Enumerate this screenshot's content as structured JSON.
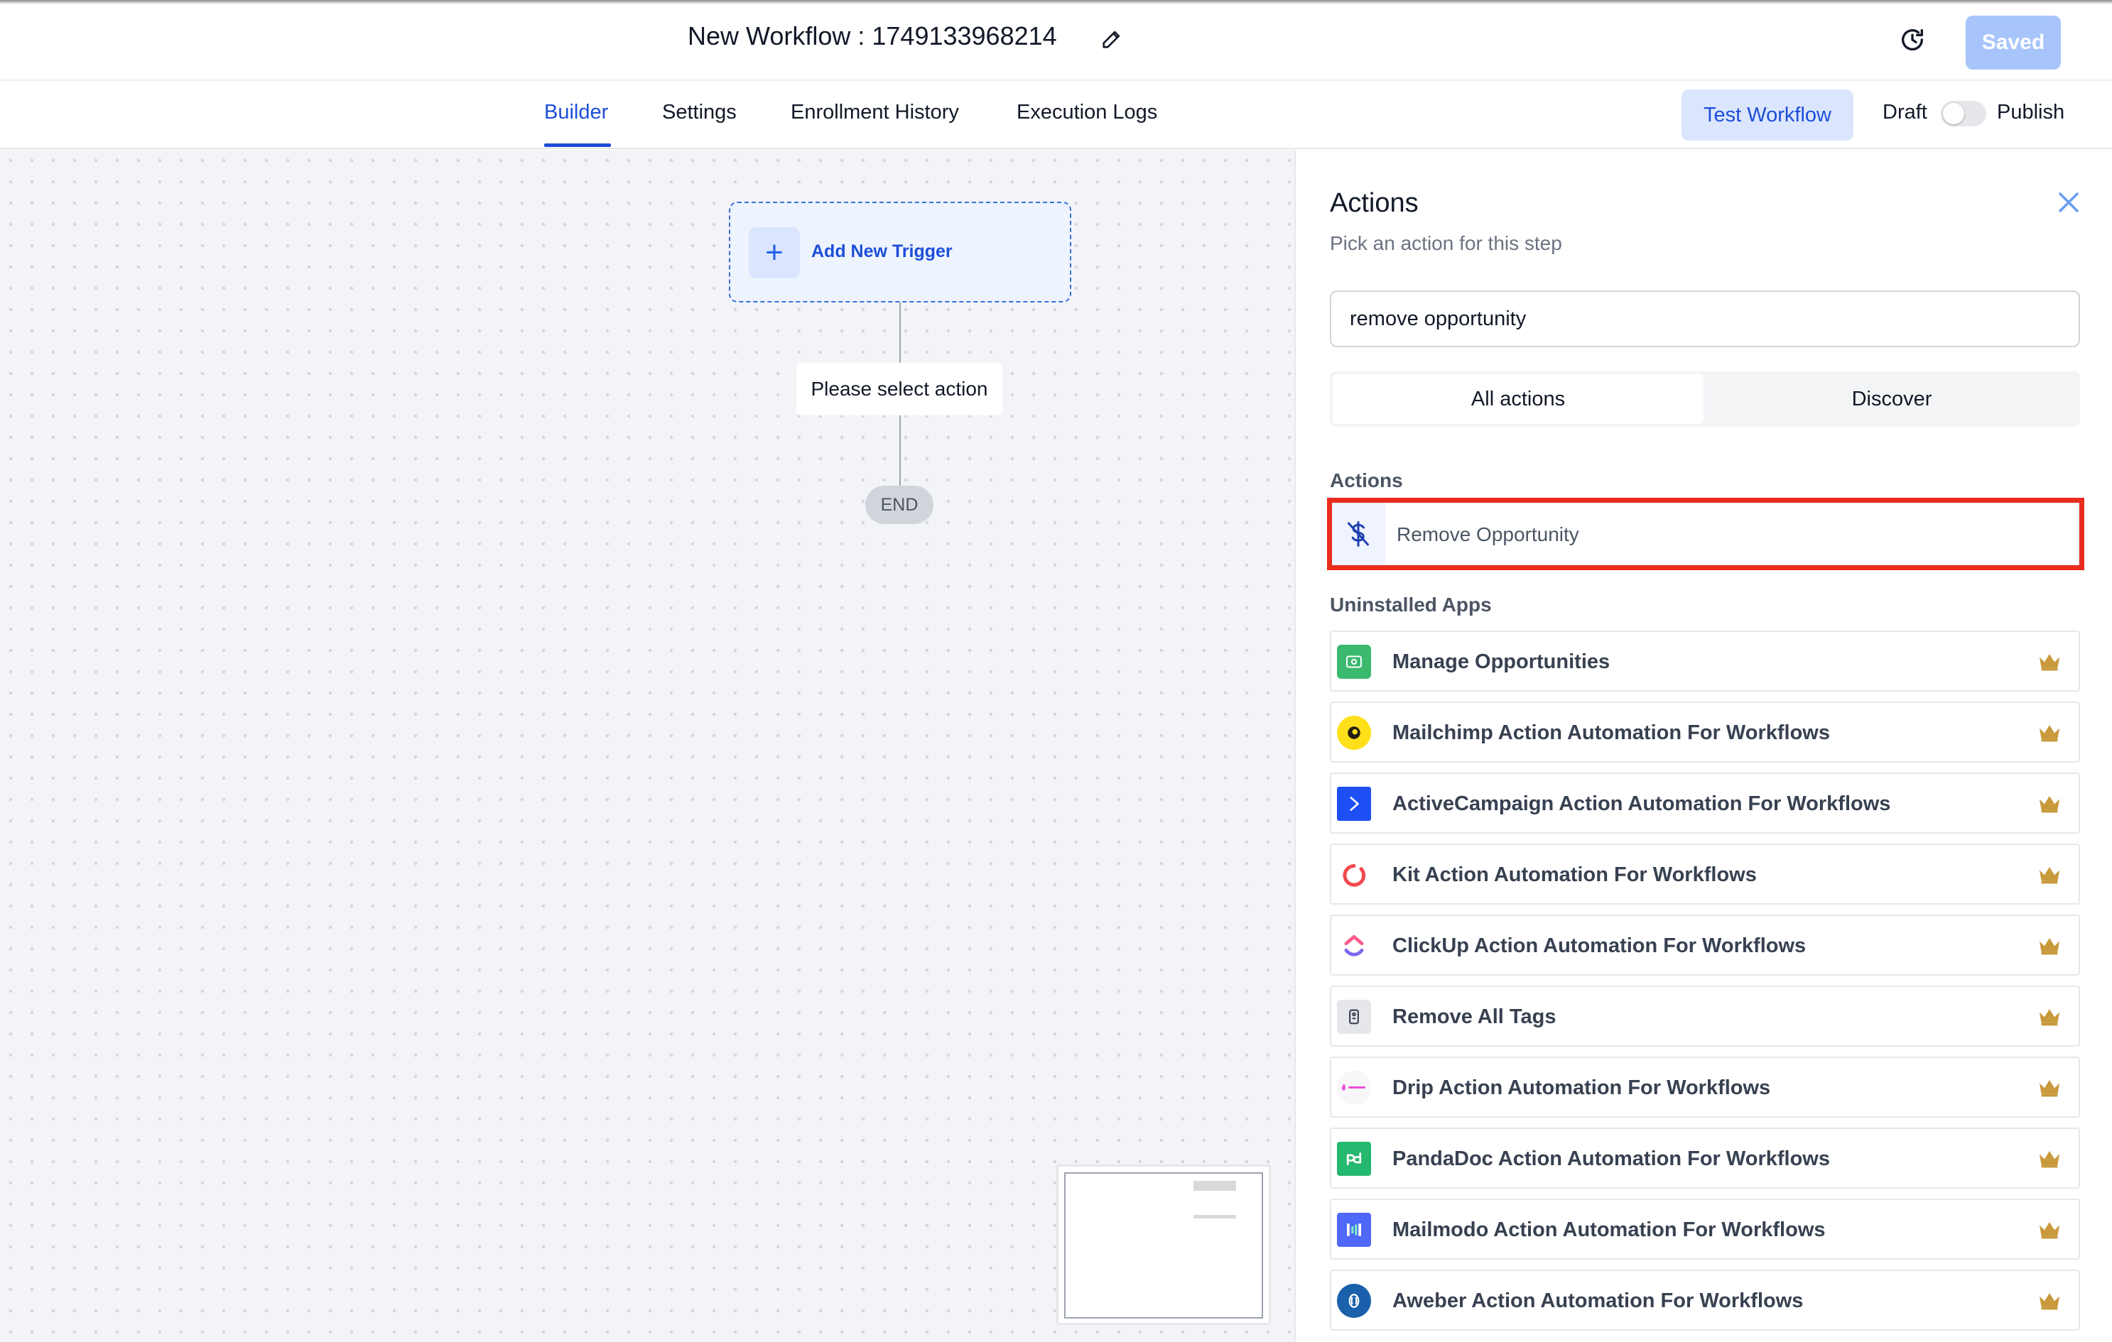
{
  "header": {
    "workflow_title": "New Workflow : 1749133968214",
    "saved_label": "Saved"
  },
  "tabs": [
    {
      "label": "Builder",
      "active": true
    },
    {
      "label": "Settings",
      "active": false
    },
    {
      "label": "Enrollment History",
      "active": false
    },
    {
      "label": "Execution Logs",
      "active": false
    }
  ],
  "toolbar": {
    "test_workflow_label": "Test Workflow",
    "draft_label": "Draft",
    "publish_label": "Publish",
    "published": false
  },
  "canvas": {
    "trigger_label": "Add New Trigger",
    "action_placeholder": "Please select action",
    "end_label": "END"
  },
  "panel": {
    "title": "Actions",
    "subtitle": "Pick an action for this step",
    "search_value": "remove opportunity",
    "segments": [
      "All actions",
      "Discover"
    ],
    "actions_section_label": "Actions",
    "actions": [
      {
        "label": "Remove Opportunity",
        "icon": "dollar-slash-icon"
      }
    ],
    "uninstalled_section_label": "Uninstalled Apps",
    "uninstalled_apps": [
      {
        "label": "Manage Opportunities",
        "icon": "manage-opportunities-logo"
      },
      {
        "label": "Mailchimp Action Automation For Workflows",
        "icon": "mailchimp-logo"
      },
      {
        "label": "ActiveCampaign Action Automation For Workflows",
        "icon": "activecampaign-logo"
      },
      {
        "label": "Kit Action Automation For Workflows",
        "icon": "kit-logo"
      },
      {
        "label": "ClickUp Action Automation For Workflows",
        "icon": "clickup-logo"
      },
      {
        "label": "Remove All Tags",
        "icon": "remove-tags-logo"
      },
      {
        "label": "Drip Action Automation For Workflows",
        "icon": "drip-logo"
      },
      {
        "label": "PandaDoc Action Automation For Workflows",
        "icon": "pandadoc-logo"
      },
      {
        "label": "Mailmodo Action Automation For Workflows",
        "icon": "mailmodo-logo"
      },
      {
        "label": "Aweber Action Automation For Workflows",
        "icon": "aweber-logo"
      }
    ]
  },
  "colors": {
    "accent": "#1d4ed8",
    "highlight": "#ea2c1f",
    "crown": "#c89a3c"
  }
}
